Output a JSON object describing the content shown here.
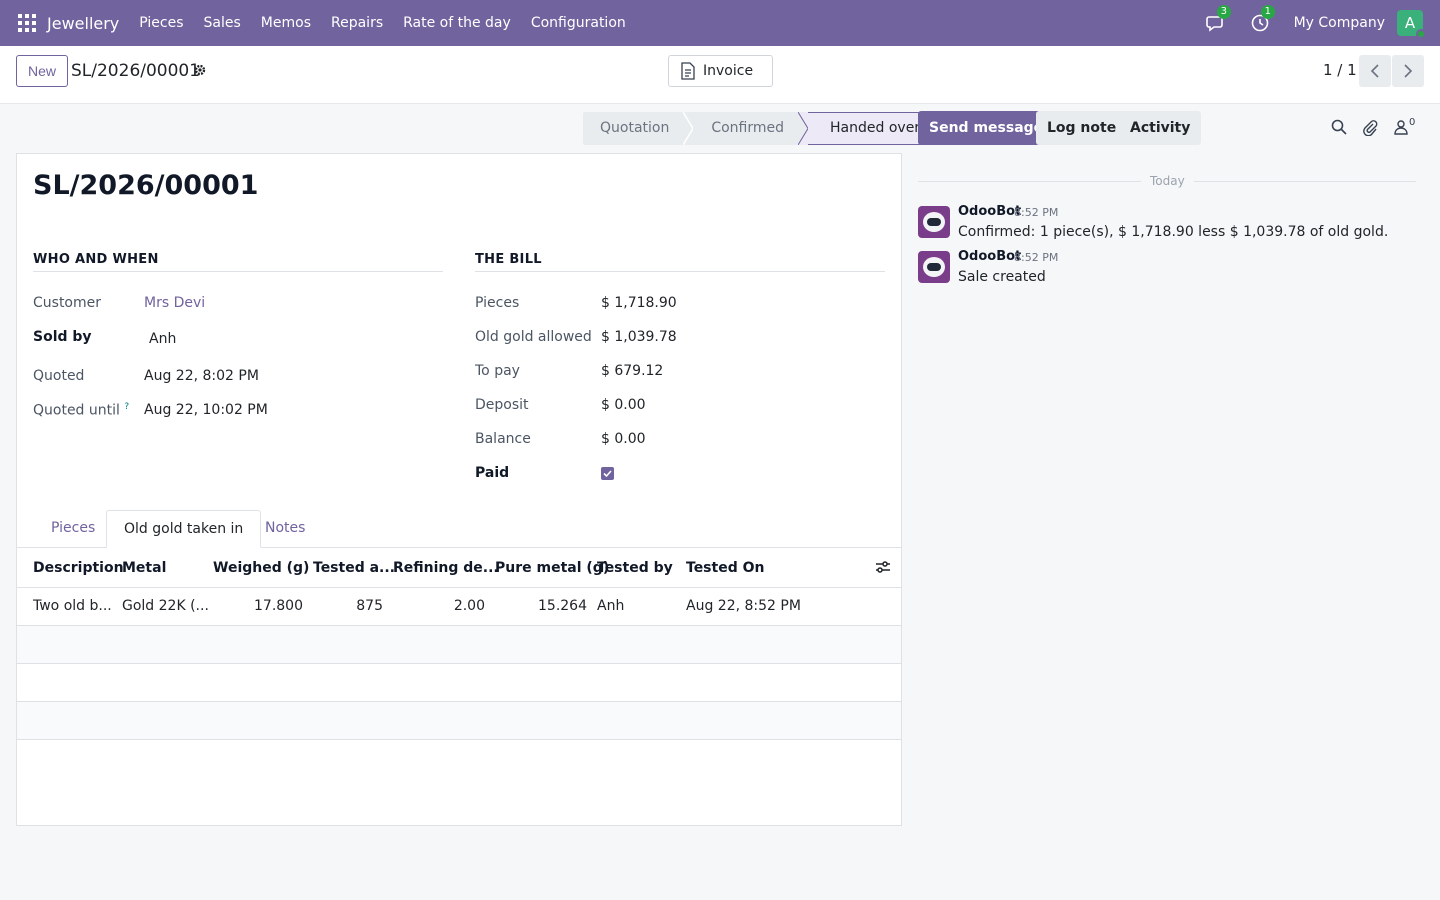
{
  "navbar": {
    "app_name": "Jewellery",
    "menu": [
      "Pieces",
      "Sales",
      "Memos",
      "Repairs",
      "Rate of the day",
      "Configuration"
    ],
    "messages_badge": "3",
    "activities_badge": "1",
    "company": "My Company",
    "avatar_letter": "A"
  },
  "control": {
    "new_label": "New",
    "record_name": "SL/2026/00001",
    "invoice_label": "Invoice",
    "pager": "1 / 1"
  },
  "statusbar": {
    "stages": [
      "Quotation",
      "Confirmed",
      "Handed over"
    ],
    "active": "Handed over"
  },
  "form": {
    "title": "SL/2026/00001",
    "who_when": {
      "heading": "WHO AND WHEN",
      "customer_label": "Customer",
      "customer": "Mrs Devi",
      "sold_by_label": "Sold by",
      "sold_by": "Anh",
      "quoted_label": "Quoted",
      "quoted": "Aug 22, 8:02 PM",
      "quoted_until_label": "Quoted until",
      "quoted_until_help": "?",
      "quoted_until": "Aug 22, 10:02 PM"
    },
    "bill": {
      "heading": "THE BILL",
      "pieces_label": "Pieces",
      "pieces": "$ 1,718.90",
      "old_gold_label": "Old gold allowed",
      "old_gold": "$ 1,039.78",
      "to_pay_label": "To pay",
      "to_pay": "$ 679.12",
      "deposit_label": "Deposit",
      "deposit": "$ 0.00",
      "balance_label": "Balance",
      "balance": "$ 0.00",
      "paid_label": "Paid",
      "paid": true
    },
    "tabs": [
      "Pieces",
      "Old gold taken in",
      "Notes"
    ],
    "active_tab": "Old gold taken in",
    "table": {
      "columns": [
        "Description",
        "Metal",
        "Weighed (g)",
        "Tested a...",
        "Refining de...",
        "Pure metal (g)",
        "Tested by",
        "Tested On"
      ],
      "rows": [
        [
          "Two old b...",
          "Gold 22K (...",
          "17.800",
          "875",
          "2.00",
          "15.264",
          "Anh",
          "Aug 22, 8:52 PM"
        ]
      ]
    }
  },
  "chatter": {
    "send_message": "Send message",
    "log_note": "Log note",
    "activity": "Activity",
    "followers": "0",
    "date_separator": "Today",
    "messages": [
      {
        "author": "OdooBot",
        "time": "8:52 PM",
        "body": "Confirmed: 1 piece(s), $ 1,718.90 less $ 1,039.78 of old gold."
      },
      {
        "author": "OdooBot",
        "time": "8:52 PM",
        "body": "Sale created"
      }
    ]
  },
  "colors": {
    "brand": "#71639e",
    "badge": "#28a745"
  }
}
